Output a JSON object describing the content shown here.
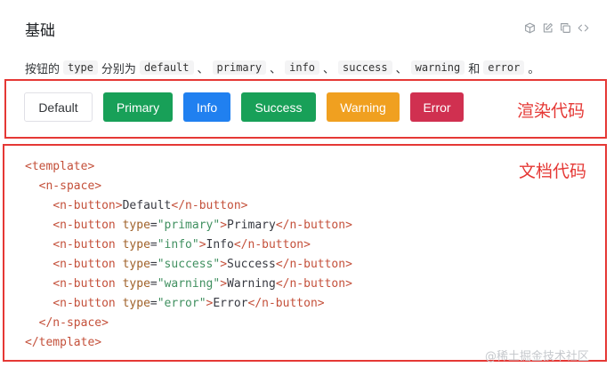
{
  "title": "基础",
  "toolbar": {
    "icons": [
      "cube-icon",
      "edit-icon",
      "copy-icon",
      "code-icon"
    ]
  },
  "description": {
    "prefix": "按钮的",
    "code_type": "type",
    "middle": "分别为",
    "values": [
      "default",
      "primary",
      "info",
      "success",
      "warning",
      "error"
    ],
    "separator": "、",
    "conjunction": "和",
    "suffix": "。"
  },
  "buttons": {
    "default": "Default",
    "primary": "Primary",
    "info": "Info",
    "success": "Success",
    "warning": "Warning",
    "error": "Error"
  },
  "colors": {
    "primary": "#18a058",
    "info": "#2080f0",
    "success": "#18a058",
    "warning": "#f0a020",
    "error": "#d03050",
    "annotation": "#e53835"
  },
  "annotations": {
    "render": "渲染代码",
    "doc": "文档代码"
  },
  "code": {
    "template_open": "<template>",
    "space_open": "<n-space>",
    "lines": [
      {
        "type": "",
        "label": "Default"
      },
      {
        "type": "primary",
        "label": "Primary"
      },
      {
        "type": "info",
        "label": "Info"
      },
      {
        "type": "success",
        "label": "Success"
      },
      {
        "type": "warning",
        "label": "Warning"
      },
      {
        "type": "error",
        "label": "Error"
      }
    ],
    "space_close": "</n-space>",
    "template_close": "</template>"
  },
  "watermark": "@稀土掘金技术社区"
}
